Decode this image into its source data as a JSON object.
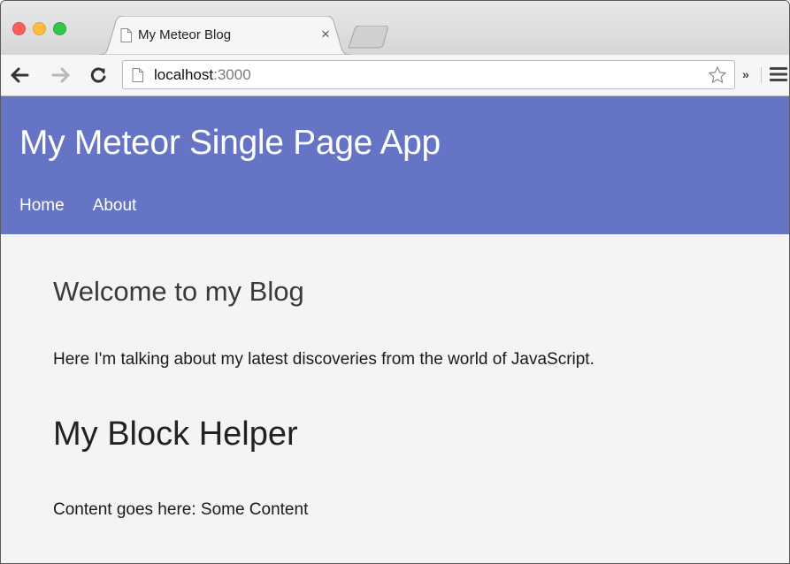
{
  "browser": {
    "tab": {
      "title": "My Meteor Blog",
      "close_glyph": "×"
    },
    "omnibox": {
      "url_host": "localhost",
      "url_port": ":3000"
    },
    "toolbar": {
      "extensions_glyph": "»"
    },
    "icons": [
      "close-window-icon",
      "minimize-window-icon",
      "maximize-window-icon",
      "page-icon",
      "back-arrow-icon",
      "forward-arrow-icon",
      "reload-icon",
      "bookmark-star-icon",
      "hamburger-menu-icon"
    ],
    "colors": {
      "close": "#fc605c",
      "minimize": "#fdbc40",
      "maximize": "#34c84a"
    }
  },
  "app": {
    "title": "My Meteor Single Page App",
    "nav": [
      {
        "label": "Home"
      },
      {
        "label": "About"
      }
    ],
    "colors": {
      "header_bg": "#6574c4",
      "page_bg": "#f4f4f4"
    }
  },
  "content": {
    "welcome_heading": "Welcome to my Blog",
    "intro": "Here I'm talking about my latest discoveries from the world of JavaScript.",
    "block_heading": "My Block Helper",
    "block_content": "Content goes here: Some Content"
  }
}
